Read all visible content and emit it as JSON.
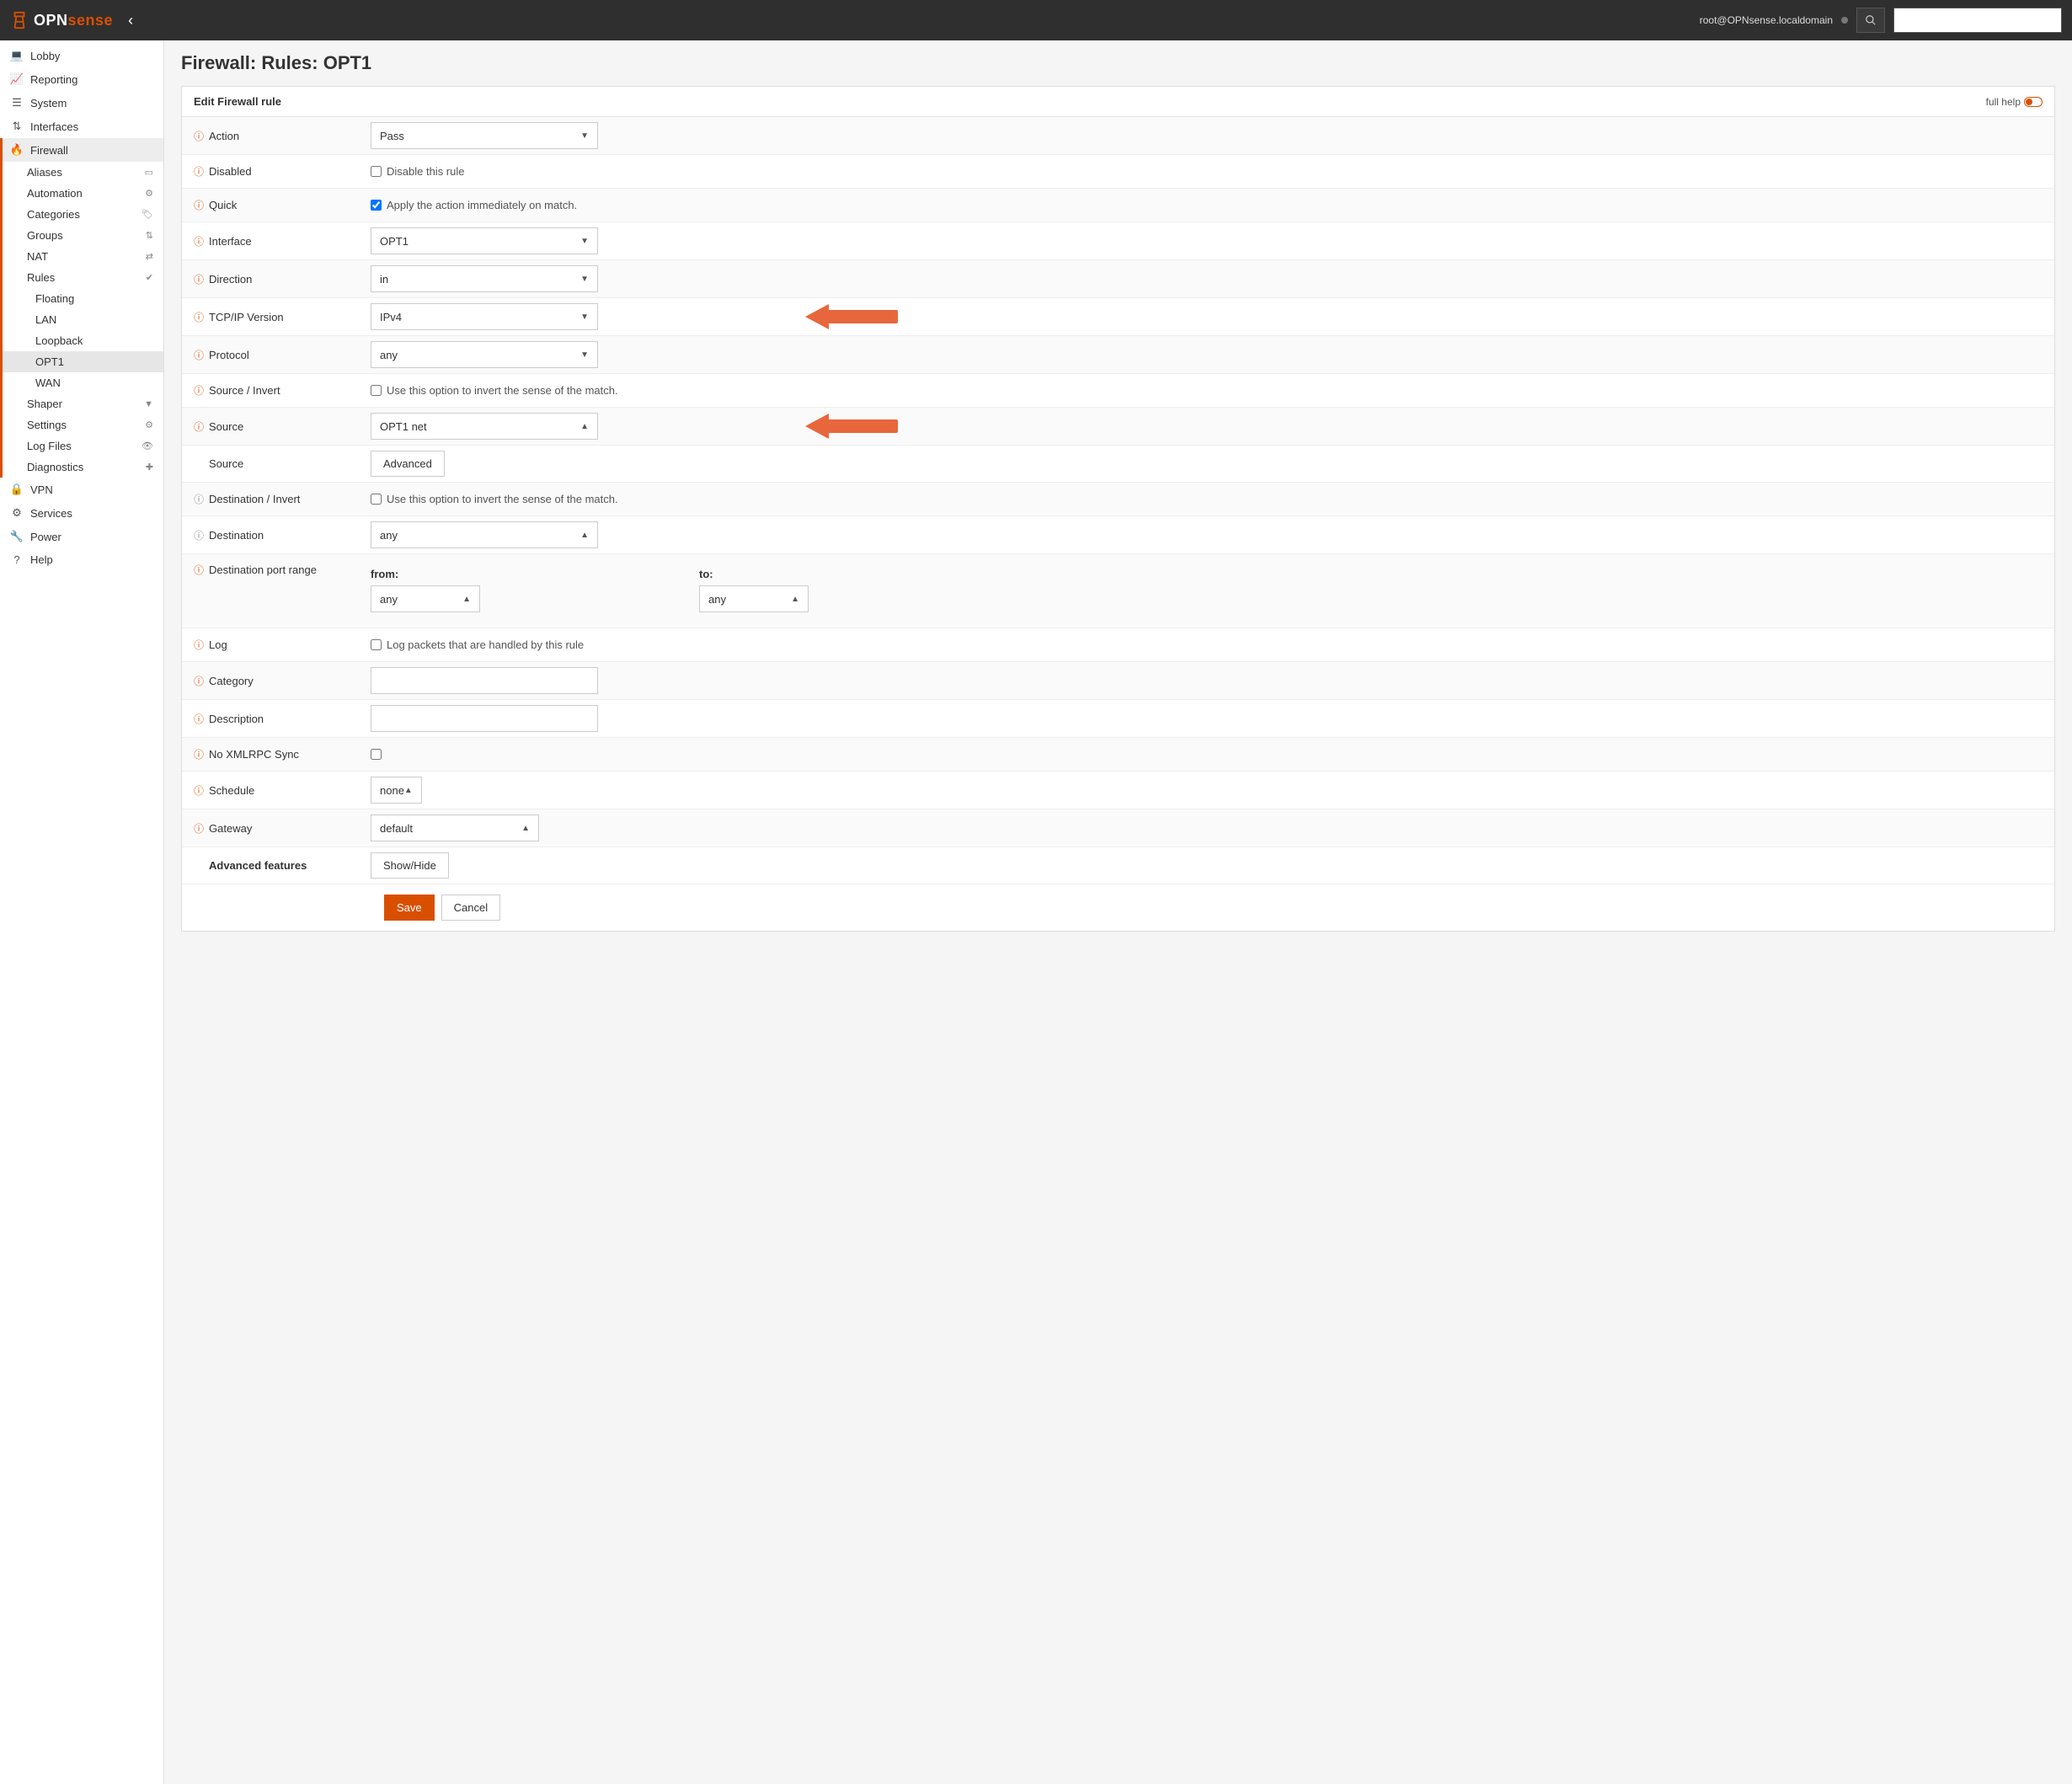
{
  "header": {
    "brand_opn": "OPN",
    "brand_sense": "sense",
    "user": "root@OPNsense.localdomain"
  },
  "sidebar": {
    "top": [
      {
        "label": "Lobby",
        "icon": "laptop"
      },
      {
        "label": "Reporting",
        "icon": "chart"
      },
      {
        "label": "System",
        "icon": "server"
      },
      {
        "label": "Interfaces",
        "icon": "sitemap"
      }
    ],
    "firewall": {
      "label": "Firewall",
      "items": [
        {
          "label": "Aliases",
          "icon": "card"
        },
        {
          "label": "Automation",
          "icon": "gear"
        },
        {
          "label": "Categories",
          "icon": "tag"
        },
        {
          "label": "Groups",
          "icon": "sitemap"
        },
        {
          "label": "NAT",
          "icon": "exchange"
        },
        {
          "label": "Rules",
          "icon": "check"
        }
      ],
      "rules_sub": [
        {
          "label": "Floating"
        },
        {
          "label": "LAN"
        },
        {
          "label": "Loopback"
        },
        {
          "label": "OPT1"
        },
        {
          "label": "WAN"
        }
      ],
      "items2": [
        {
          "label": "Shaper",
          "icon": "filter"
        },
        {
          "label": "Settings",
          "icon": "gear"
        },
        {
          "label": "Log Files",
          "icon": "eye"
        },
        {
          "label": "Diagnostics",
          "icon": "medkit"
        }
      ]
    },
    "bottom": [
      {
        "label": "VPN",
        "icon": "lock"
      },
      {
        "label": "Services",
        "icon": "gear"
      },
      {
        "label": "Power",
        "icon": "wrench"
      },
      {
        "label": "Help",
        "icon": "question"
      }
    ]
  },
  "page": {
    "title": "Firewall: Rules: OPT1",
    "panel_title": "Edit Firewall rule",
    "fullhelp": "full help"
  },
  "form": {
    "action": {
      "label": "Action",
      "value": "Pass"
    },
    "disabled": {
      "label": "Disabled",
      "text": "Disable this rule"
    },
    "quick": {
      "label": "Quick",
      "text": "Apply the action immediately on match."
    },
    "interface": {
      "label": "Interface",
      "value": "OPT1"
    },
    "direction": {
      "label": "Direction",
      "value": "in"
    },
    "tcpip": {
      "label": "TCP/IP Version",
      "value": "IPv4"
    },
    "protocol": {
      "label": "Protocol",
      "value": "any"
    },
    "src_invert": {
      "label": "Source / Invert",
      "text": "Use this option to invert the sense of the match."
    },
    "source": {
      "label": "Source",
      "value": "OPT1 net"
    },
    "source_adv": {
      "label": "Source",
      "button": "Advanced"
    },
    "dst_invert": {
      "label": "Destination / Invert",
      "text": "Use this option to invert the sense of the match."
    },
    "destination": {
      "label": "Destination",
      "value": "any"
    },
    "dst_port": {
      "label": "Destination port range",
      "from_label": "from:",
      "to_label": "to:",
      "from_value": "any",
      "to_value": "any"
    },
    "log": {
      "label": "Log",
      "text": "Log packets that are handled by this rule"
    },
    "category": {
      "label": "Category"
    },
    "description": {
      "label": "Description"
    },
    "xmlrpc": {
      "label": "No XMLRPC Sync"
    },
    "schedule": {
      "label": "Schedule",
      "value": "none"
    },
    "gateway": {
      "label": "Gateway",
      "value": "default"
    },
    "advanced": {
      "label": "Advanced features",
      "button": "Show/Hide"
    },
    "save": "Save",
    "cancel": "Cancel"
  }
}
